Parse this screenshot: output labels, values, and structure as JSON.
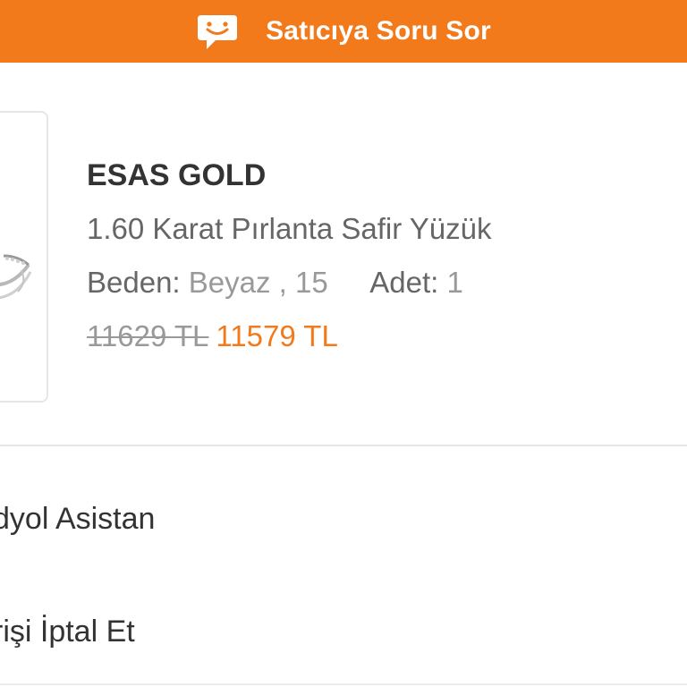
{
  "ask_seller": {
    "label": "Satıcıya Soru Sor",
    "icon": "chat-smile-icon"
  },
  "product": {
    "image": "ring-image",
    "brand": "ESAS GOLD",
    "name": "1.60 Karat Pırlanta Safir Yüzük",
    "size_label": "Beden:",
    "size_value": "Beyaz , 15",
    "qty_label": "Adet:",
    "qty_value": "1",
    "old_price": "11629 TL",
    "new_price": "11579 TL"
  },
  "menu": {
    "assistant": "dyol Asistan",
    "cancel": "rişi İptal Et"
  },
  "colors": {
    "accent": "#f27a1a",
    "text_dark": "#333333",
    "text_mid": "#666666",
    "text_light": "#999999"
  }
}
